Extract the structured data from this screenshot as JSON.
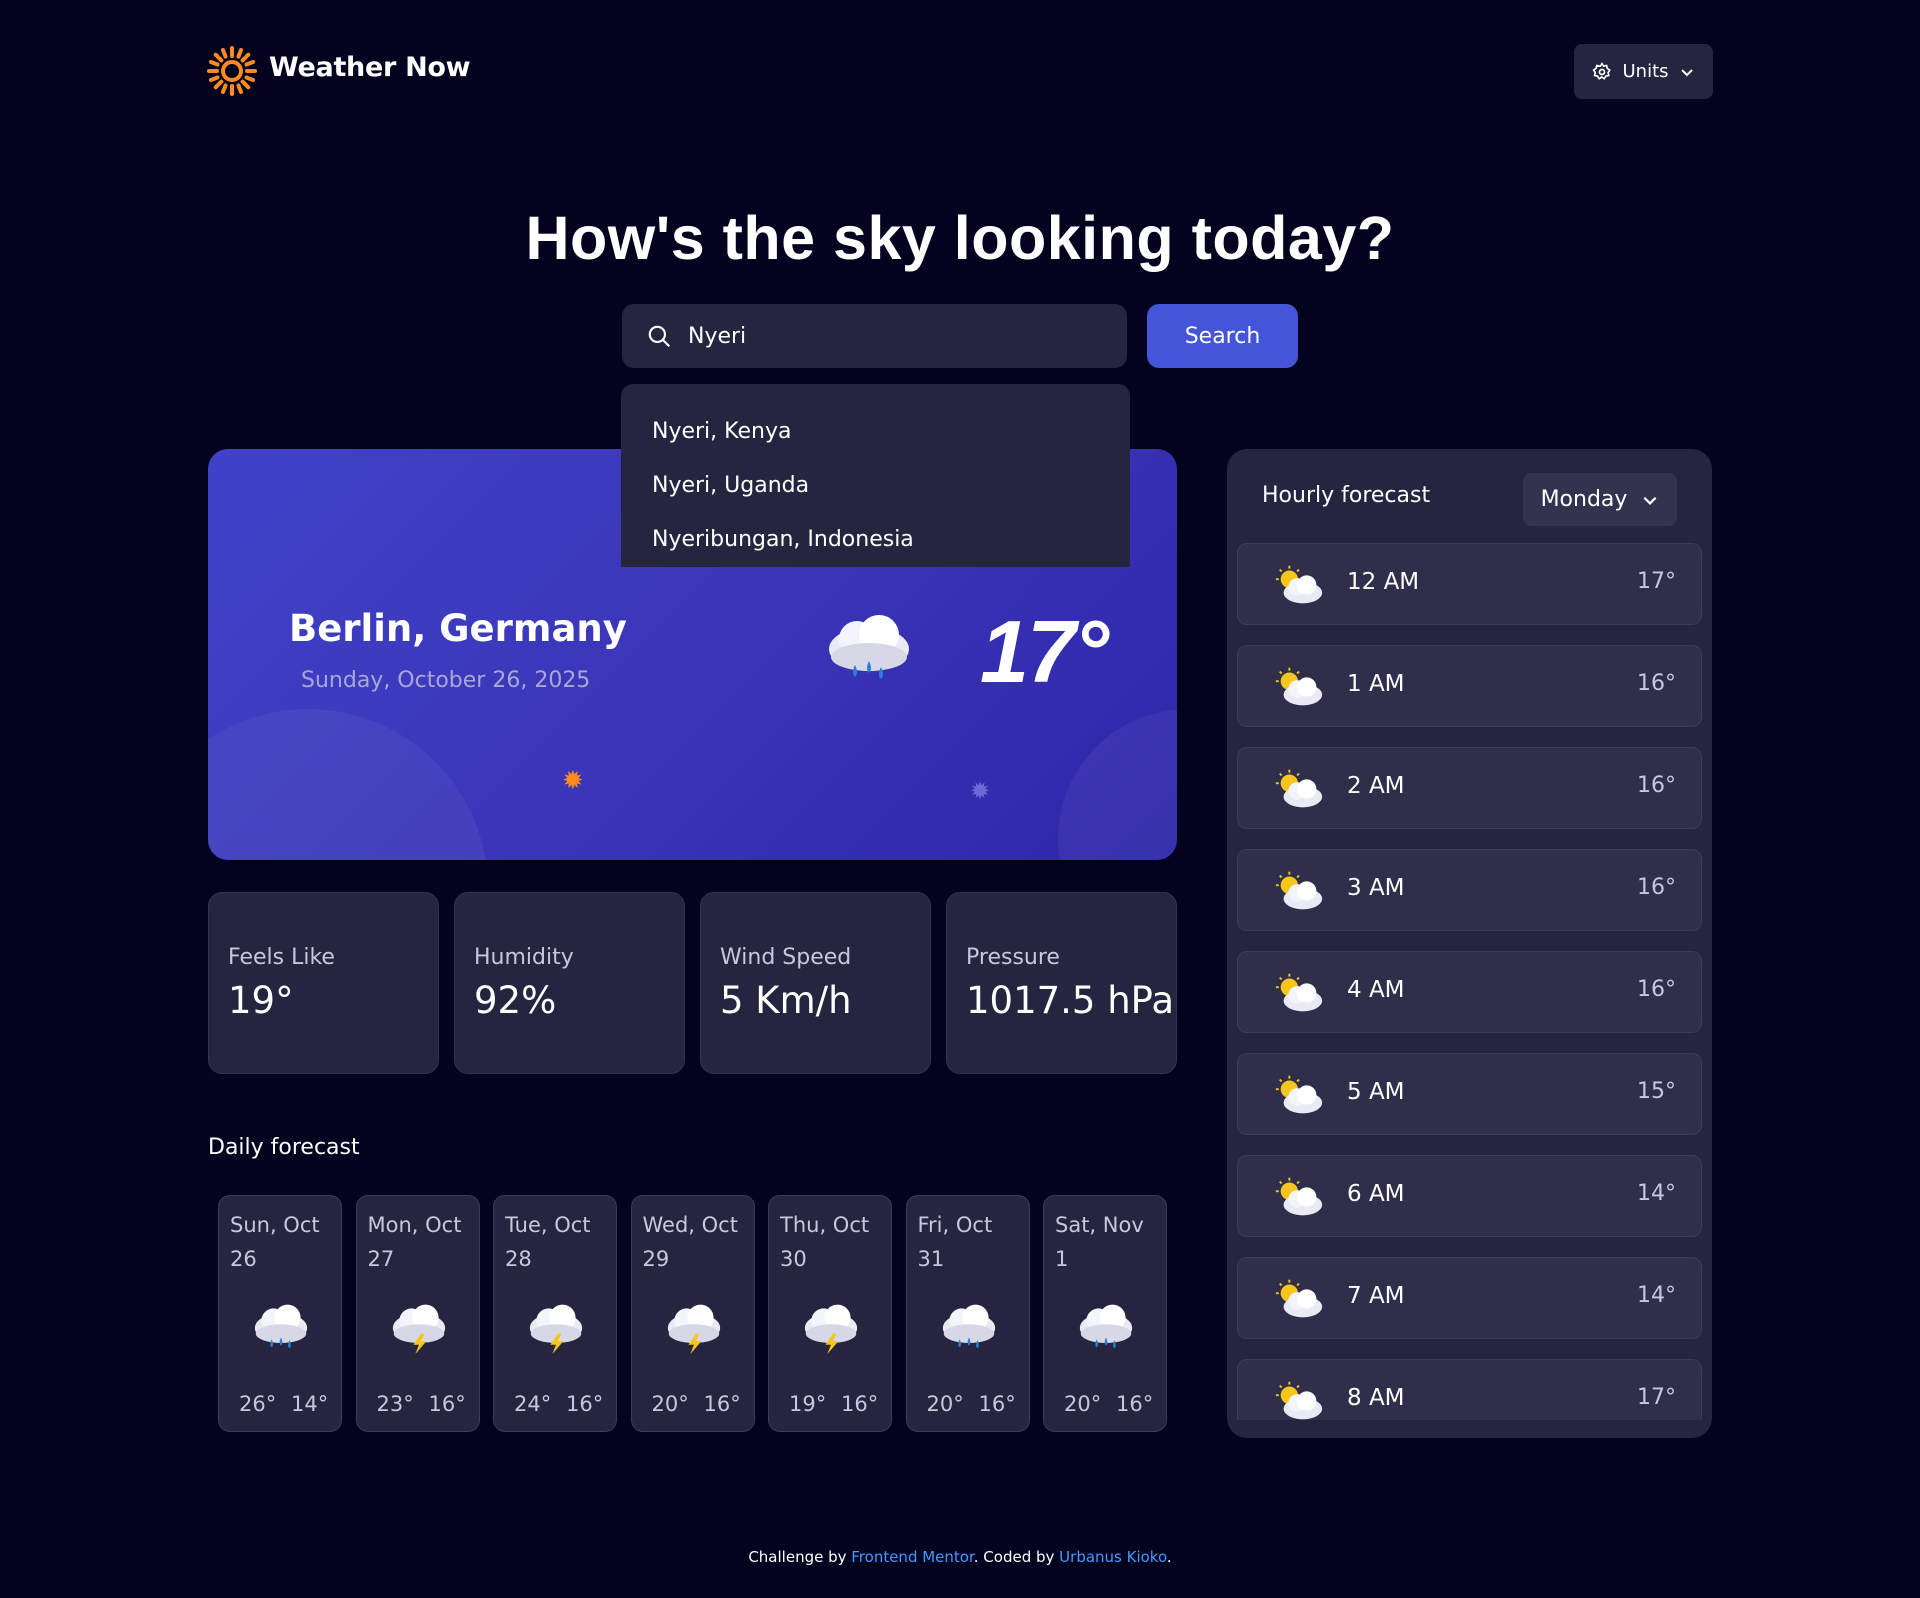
{
  "header": {
    "brand": "Weather Now",
    "units_label": "Units"
  },
  "hero": {
    "title": "How's the sky looking today?"
  },
  "search": {
    "value": "Nyeri",
    "button_label": "Search",
    "suggestions": [
      "Nyeri, Kenya",
      "Nyeri, Uganda",
      "Nyeribungan, Indonesia"
    ]
  },
  "current": {
    "city": "Berlin, Germany",
    "date": "Sunday, October 26, 2025",
    "temperature": "17°",
    "icon": "rain-icon"
  },
  "stats": [
    {
      "label": "Feels Like",
      "value": "19°"
    },
    {
      "label": "Humidity",
      "value": "92%"
    },
    {
      "label": "Wind Speed",
      "value": "5 Km/h"
    },
    {
      "label": "Pressure",
      "value": "1017.5 hPa"
    }
  ],
  "daily": {
    "title": "Daily forecast",
    "days": [
      {
        "line1": "Sun, Oct",
        "line2": "26",
        "icon": "rain-icon",
        "hi": "26°",
        "lo": "14°"
      },
      {
        "line1": "Mon, Oct",
        "line2": "27",
        "icon": "storm-icon",
        "hi": "23°",
        "lo": "16°"
      },
      {
        "line1": "Tue, Oct",
        "line2": "28",
        "icon": "storm-icon",
        "hi": "24°",
        "lo": "16°"
      },
      {
        "line1": "Wed, Oct",
        "line2": "29",
        "icon": "storm-icon",
        "hi": "20°",
        "lo": "16°"
      },
      {
        "line1": "Thu, Oct",
        "line2": "30",
        "icon": "storm-icon",
        "hi": "19°",
        "lo": "16°"
      },
      {
        "line1": "Fri, Oct",
        "line2": "31",
        "icon": "rain-icon",
        "hi": "20°",
        "lo": "16°"
      },
      {
        "line1": "Sat, Nov",
        "line2": "1",
        "icon": "rain-icon",
        "hi": "20°",
        "lo": "16°"
      }
    ]
  },
  "hourly": {
    "title": "Hourly forecast",
    "selected_day": "Monday",
    "hours": [
      {
        "time": "12 AM",
        "temp": "17°",
        "icon": "partly-cloudy-icon"
      },
      {
        "time": "1 AM",
        "temp": "16°",
        "icon": "partly-cloudy-icon"
      },
      {
        "time": "2 AM",
        "temp": "16°",
        "icon": "partly-cloudy-icon"
      },
      {
        "time": "3 AM",
        "temp": "16°",
        "icon": "partly-cloudy-icon"
      },
      {
        "time": "4 AM",
        "temp": "16°",
        "icon": "partly-cloudy-icon"
      },
      {
        "time": "5 AM",
        "temp": "15°",
        "icon": "partly-cloudy-icon"
      },
      {
        "time": "6 AM",
        "temp": "14°",
        "icon": "partly-cloudy-icon"
      },
      {
        "time": "7 AM",
        "temp": "14°",
        "icon": "partly-cloudy-icon"
      },
      {
        "time": "8 AM",
        "temp": "17°",
        "icon": "partly-cloudy-icon"
      }
    ]
  },
  "footer": {
    "prefix": "Challenge by ",
    "link1": "Frontend Mentor",
    "middle": ". Coded by ",
    "link2": "Urbanus Kioko",
    "suffix": "."
  },
  "colors": {
    "background": "#03031f",
    "surface": "#262540",
    "accent": "#4455da",
    "sun": "#ff8a1d",
    "link": "#3e9bff"
  }
}
